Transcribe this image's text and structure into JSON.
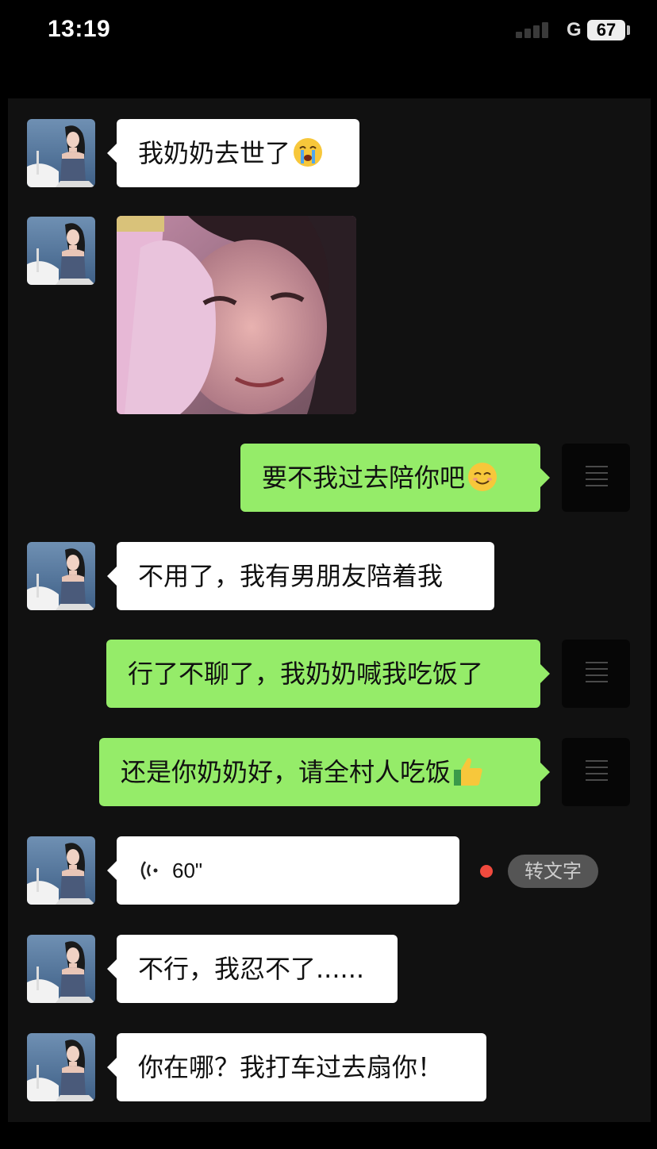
{
  "status_bar": {
    "time": "13:19",
    "network": "G",
    "battery": "67"
  },
  "messages": [
    {
      "side": "in",
      "type": "text",
      "text": "我奶奶去世了",
      "emoji": "crying-face"
    },
    {
      "side": "in",
      "type": "image",
      "alt": "selfie photo"
    },
    {
      "side": "out",
      "type": "text",
      "text": "要不我过去陪你吧",
      "emoji": "smiling-face"
    },
    {
      "side": "in",
      "type": "text",
      "text": "不用了，我有男朋友陪着我"
    },
    {
      "side": "out",
      "type": "text",
      "text": "行了不聊了，我奶奶喊我吃饭了"
    },
    {
      "side": "out",
      "type": "text",
      "text": "还是你奶奶好，请全村人吃饭",
      "emoji": "thumbs-up"
    },
    {
      "side": "in",
      "type": "voice",
      "duration": "60\"",
      "unread": true
    },
    {
      "side": "in",
      "type": "text",
      "text": "不行，我忍不了......"
    },
    {
      "side": "in",
      "type": "text",
      "text": "你在哪？我打车过去扇你！"
    }
  ],
  "voice_actions": {
    "transcribe_label": "转文字"
  },
  "colors": {
    "incoming_bubble": "#ffffff",
    "outgoing_bubble": "#95ec69",
    "chat_background": "#111111",
    "unread_dot": "#f04a3e"
  }
}
